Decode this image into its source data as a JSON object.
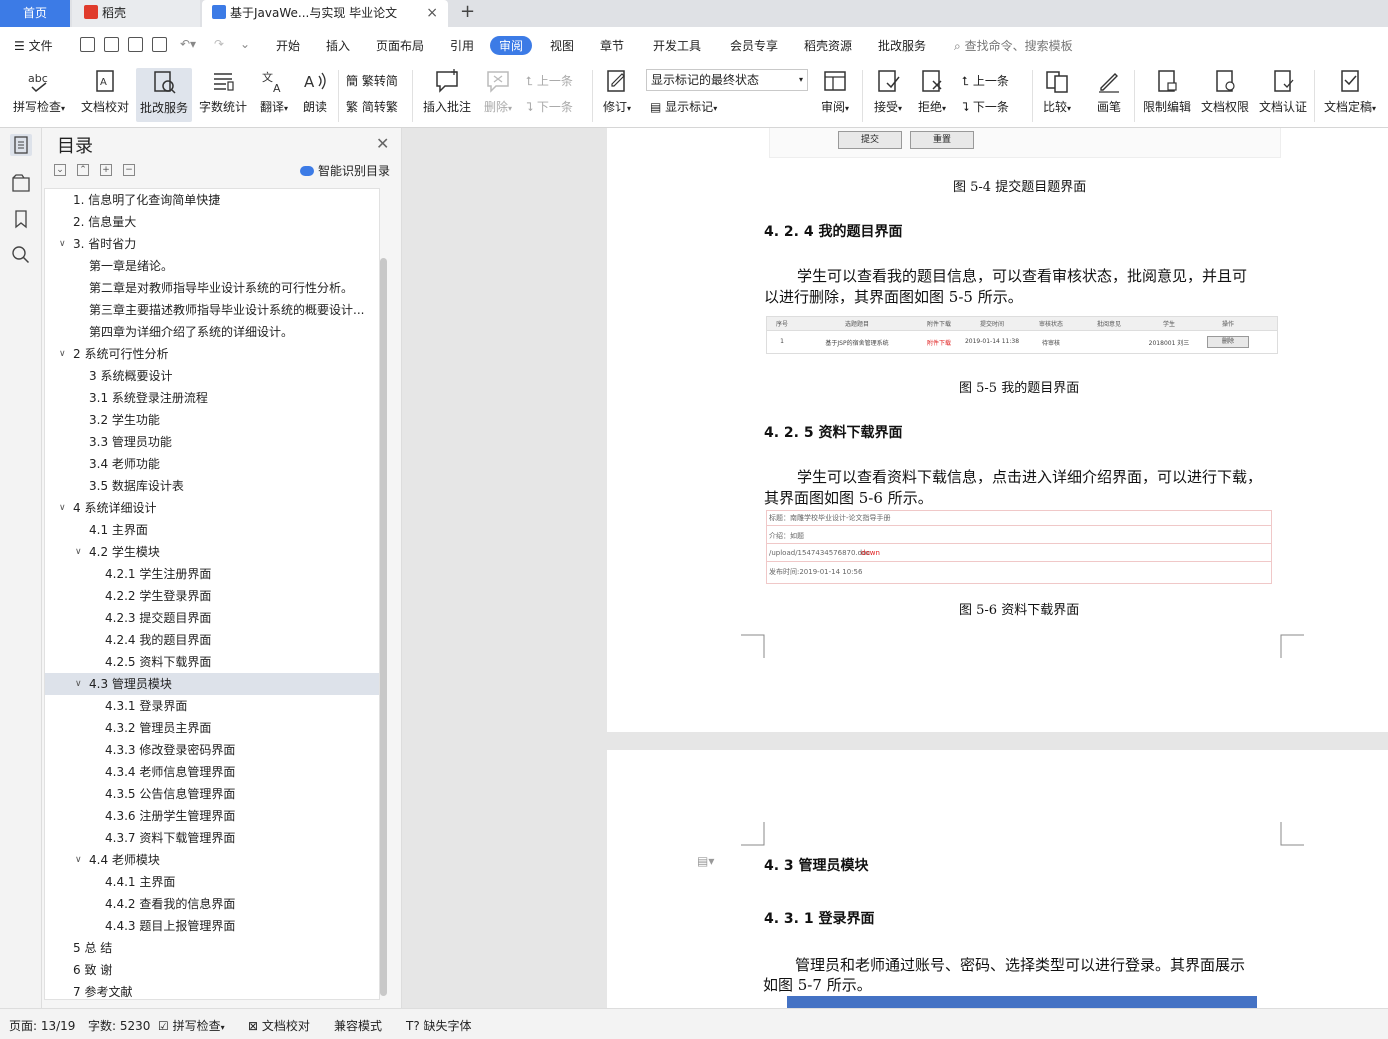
{
  "tabs": {
    "home": "首页",
    "daoke": "稻壳",
    "doc": "基于JavaWe...与实现 毕业论文",
    "close": "×",
    "add": "+"
  },
  "menu": {
    "file": "文件",
    "items": [
      "开始",
      "插入",
      "页面布局",
      "引用",
      "审阅",
      "视图",
      "章节",
      "开发工具",
      "会员专享",
      "稻壳资源",
      "批改服务"
    ],
    "active": "审阅",
    "search_placeholder": "查找命令、搜索模板"
  },
  "ribbon": {
    "spell": "拼写检查",
    "proof": "文档校对",
    "review_service": "批改服务",
    "word_count": "字数统计",
    "translate": "翻译",
    "read": "朗读",
    "trad": "繁转简",
    "simp": "简转繁",
    "insert_comment": "插入批注",
    "delete": "删除",
    "prev": "上一条",
    "next": "下一条",
    "revise": "修订",
    "state_value": "显示标记的最终状态",
    "show_marks": "显示标记",
    "review": "审阅",
    "accept": "接受",
    "reject": "拒绝",
    "prev2": "上一条",
    "next2": "下一条",
    "compare": "比较",
    "pen": "画笔",
    "restrict": "限制编辑",
    "permission": "文档权限",
    "certify": "文档认证",
    "finalize": "文档定稿"
  },
  "toc": {
    "title": "目录",
    "smart": "智能识别目录",
    "items": [
      {
        "label": "1. 信息明了化查询简单快捷",
        "level": 0,
        "arrow": ""
      },
      {
        "label": "2. 信息量大",
        "level": 0,
        "arrow": ""
      },
      {
        "label": "3. 省时省力",
        "level": 0,
        "arrow": "v"
      },
      {
        "label": "第一章是绪论。",
        "level": 1,
        "arrow": ""
      },
      {
        "label": "第二章是对教师指导毕业设计系统的可行性分析。",
        "level": 1,
        "arrow": ""
      },
      {
        "label": "第三章主要描述教师指导毕业设计系统的概要设计...",
        "level": 1,
        "arrow": ""
      },
      {
        "label": "第四章为详细介绍了系统的详细设计。",
        "level": 1,
        "arrow": ""
      },
      {
        "label": "2  系统可行性分析",
        "level": 0,
        "arrow": "v"
      },
      {
        "label": "3 系统概要设计",
        "level": 1,
        "arrow": ""
      },
      {
        "label": "3.1 系统登录注册流程",
        "level": 1,
        "arrow": ""
      },
      {
        "label": "3.2 学生功能",
        "level": 1,
        "arrow": ""
      },
      {
        "label": "3.3 管理员功能",
        "level": 1,
        "arrow": ""
      },
      {
        "label": "3.4 老师功能",
        "level": 1,
        "arrow": ""
      },
      {
        "label": "3.5 数据库设计表",
        "level": 1,
        "arrow": ""
      },
      {
        "label": "4 系统详细设计",
        "level": 0,
        "arrow": "v"
      },
      {
        "label": "4.1 主界面",
        "level": 1,
        "arrow": ""
      },
      {
        "label": "4.2 学生模块",
        "level": 1,
        "arrow": "v"
      },
      {
        "label": "4.2.1 学生注册界面",
        "level": 2,
        "arrow": ""
      },
      {
        "label": "4.2.2 学生登录界面",
        "level": 2,
        "arrow": ""
      },
      {
        "label": "4.2.3 提交题目界面",
        "level": 2,
        "arrow": ""
      },
      {
        "label": "4.2.4 我的题目界面",
        "level": 2,
        "arrow": ""
      },
      {
        "label": "4.2.5 资料下载界面",
        "level": 2,
        "arrow": ""
      },
      {
        "label": "4.3 管理员模块",
        "level": 1,
        "arrow": "v",
        "selected": true
      },
      {
        "label": "4.3.1 登录界面",
        "level": 2,
        "arrow": ""
      },
      {
        "label": "4.3.2 管理员主界面",
        "level": 2,
        "arrow": ""
      },
      {
        "label": "4.3.3 修改登录密码界面",
        "level": 2,
        "arrow": ""
      },
      {
        "label": "4.3.4 老师信息管理界面",
        "level": 2,
        "arrow": ""
      },
      {
        "label": "4.3.5 公告信息管理界面",
        "level": 2,
        "arrow": ""
      },
      {
        "label": "4.3.6 注册学生管理界面",
        "level": 2,
        "arrow": ""
      },
      {
        "label": "4.3.7 资料下载管理界面",
        "level": 2,
        "arrow": ""
      },
      {
        "label": "4.4 老师模块",
        "level": 1,
        "arrow": "v"
      },
      {
        "label": "4.4.1 主界面",
        "level": 2,
        "arrow": ""
      },
      {
        "label": "4.4.2 查看我的信息界面",
        "level": 2,
        "arrow": ""
      },
      {
        "label": "4.4.3 题目上报管理界面",
        "level": 2,
        "arrow": ""
      },
      {
        "label": "5 总 结",
        "level": 0,
        "arrow": ""
      },
      {
        "label": "6 致 谢",
        "level": 0,
        "arrow": ""
      },
      {
        "label": "7 参考文献",
        "level": 0,
        "arrow": ""
      }
    ]
  },
  "doc": {
    "btn_submit": "提交",
    "btn_reset": "重置",
    "cap_5_4": "图 5-4 提交题目题界面",
    "h_424": "4. 2. 4 我的题目界面",
    "p_424_l1": "学生可以查看我的题目信息，可以查看审核状态，批阅意见，并且可",
    "p_424_l2": "以进行删除，其界面图如图 5-5 所示。",
    "table_headers": [
      "序号",
      "选题题目",
      "附件下载",
      "提交时间",
      "审核状态",
      "批阅意见",
      "学生",
      "操作"
    ],
    "table_row": [
      "1",
      "基于JSP的宿舍管理系统",
      "附件下载",
      "2019-01-14 11:38",
      "待审核",
      "",
      "2018001  刘三",
      "删除"
    ],
    "cap_5_5": "图 5-5 我的题目界面",
    "h_425": "4. 2. 5 资料下载界面",
    "p_425_l1": "学生可以查看资料下载信息，点击进入详细介绍界面，可以进行下载，",
    "p_425_l2": "其界面图如图 5-6 所示。",
    "dl_title": "标题：南雕学校毕业设计-论文指导手册",
    "dl_intro": "介绍：如题",
    "dl_path": "/upload/1547434576870.doc",
    "dl_down": "down",
    "dl_time": "发布时间:2019-01-14 10:56",
    "cap_5_6": "图 5-6 资料下载界面",
    "h_43": "4. 3 管理员模块",
    "h_431": "4. 3. 1 登录界面",
    "p_431_l1": "管理员和老师通过账号、密码、选择类型可以进行登录。其界面展示",
    "p_431_l2": "如图 5-7 所示。"
  },
  "status": {
    "page": "页面: 13/19",
    "words": "字数: 5230",
    "spell": "拼写检查",
    "proof": "文档校对",
    "compat": "兼容模式",
    "missing_font": "缺失字体"
  },
  "colors": {
    "accent": "#3c7be6",
    "selected_bg": "#dde2ea",
    "red_text": "#e02020"
  }
}
